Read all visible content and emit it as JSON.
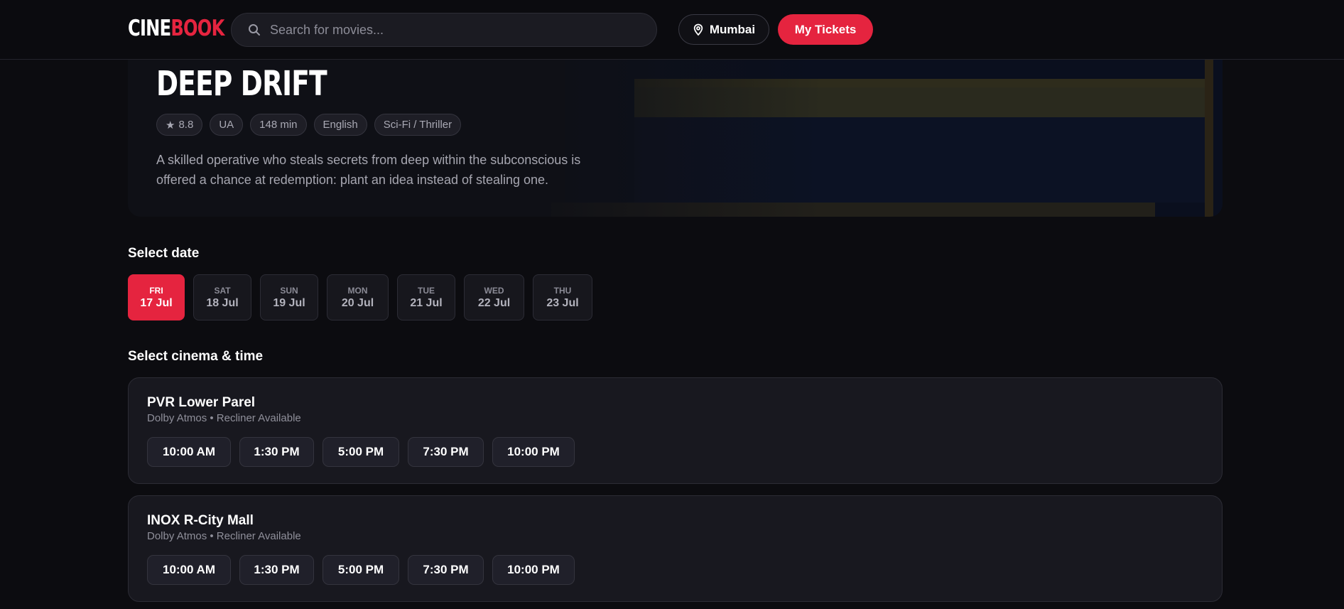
{
  "brand": {
    "part1": "CINE",
    "part2": "BOOK"
  },
  "search": {
    "placeholder": "Search for movies...",
    "icon": "search-icon"
  },
  "header": {
    "city": "Mumbai",
    "city_icon": "location-pin-icon",
    "tickets_label": "My Tickets"
  },
  "movie": {
    "title": "DEEP DRIFT",
    "rating": "8.8",
    "rating_icon": "★",
    "certificate": "UA",
    "duration": "148 min",
    "language": "English",
    "genre": "Sci-Fi / Thriller",
    "description_line1": "A skilled operative who steals secrets from deep within the subconscious is",
    "description_line2": "offered a chance at redemption: plant an idea instead of stealing one."
  },
  "date_section": {
    "title": "Select date",
    "dates": [
      {
        "dow": "FRI",
        "date": "17 Jul",
        "selected": true
      },
      {
        "dow": "SAT",
        "date": "18 Jul",
        "selected": false
      },
      {
        "dow": "SUN",
        "date": "19 Jul",
        "selected": false
      },
      {
        "dow": "MON",
        "date": "20 Jul",
        "selected": false
      },
      {
        "dow": "TUE",
        "date": "21 Jul",
        "selected": false
      },
      {
        "dow": "WED",
        "date": "22 Jul",
        "selected": false
      },
      {
        "dow": "THU",
        "date": "23 Jul",
        "selected": false
      }
    ]
  },
  "cinema_section": {
    "title": "Select cinema & time",
    "cinemas": [
      {
        "name": "PVR Lower Parel",
        "features": "Dolby Atmos • Recliner Available",
        "times": [
          "10:00 AM",
          "1:30 PM",
          "5:00 PM",
          "7:30 PM",
          "10:00 PM"
        ]
      },
      {
        "name": "INOX R-City Mall",
        "features": "Dolby Atmos • Recliner Available",
        "times": [
          "10:00 AM",
          "1:30 PM",
          "5:00 PM",
          "7:30 PM",
          "10:00 PM"
        ]
      }
    ]
  },
  "colors": {
    "accent": "#e5243f",
    "background": "#0c0c10",
    "card": "#18181f"
  }
}
